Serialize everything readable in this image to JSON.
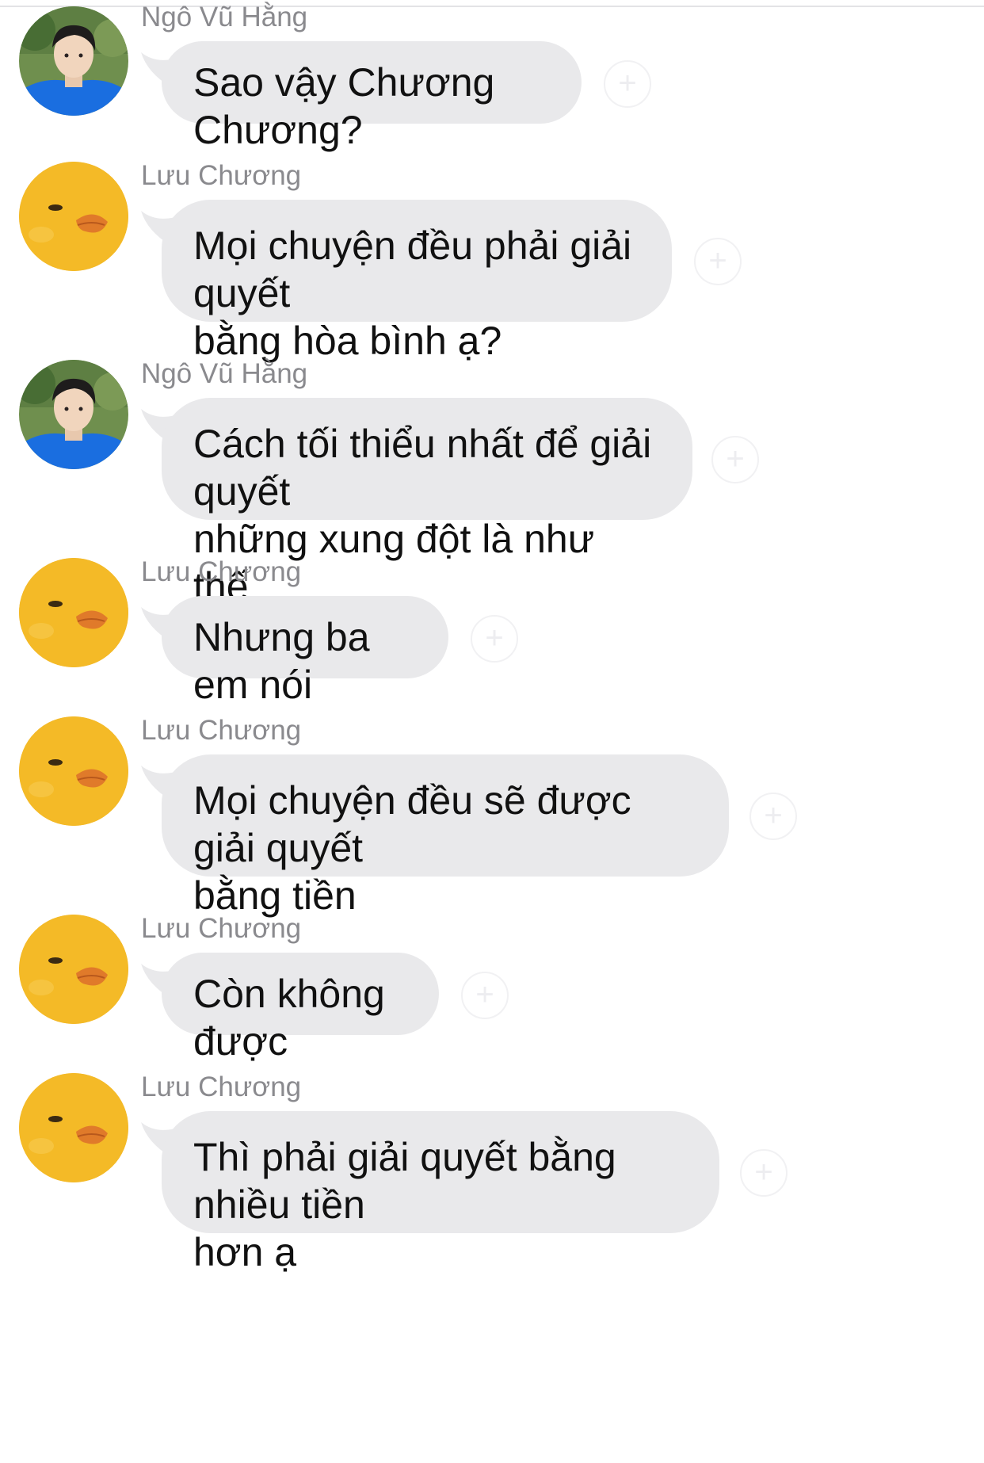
{
  "conversation": {
    "messages": [
      {
        "sender": "Ngô Vũ Hằng",
        "text": "Sao vậy Chương Chương?",
        "avatar": "boy-photo-avatar"
      },
      {
        "sender": "Lưu Chương",
        "text": "Mọi chuyện đều phải giải quyết\nbằng hòa bình ạ?",
        "avatar": "duck-avatar"
      },
      {
        "sender": "Ngô Vũ Hằng",
        "text": "Cách tối thiểu nhất để giải quyết\nnhững xung đột là như thế",
        "avatar": "boy-photo-avatar"
      },
      {
        "sender": "Lưu Chương",
        "text": "Nhưng ba em nói",
        "avatar": "duck-avatar"
      },
      {
        "sender": "Lưu Chương",
        "text": "Mọi chuyện đều sẽ được giải quyết\nbằng tiền",
        "avatar": "duck-avatar"
      },
      {
        "sender": "Lưu Chương",
        "text": "Còn không được",
        "avatar": "duck-avatar"
      },
      {
        "sender": "Lưu Chương",
        "text": "Thì phải giải quyết bằng nhiều tiền\nhơn ạ",
        "avatar": "duck-avatar"
      }
    ],
    "colors": {
      "bubble": "#e9e9eb",
      "sender_name": "#8a8a8e",
      "message_text": "#111111",
      "duck_yellow": "#f2b21c",
      "duck_beak": "#e07a2a",
      "shirt_blue": "#1a6ee0"
    },
    "icons": {
      "reaction": "add-reaction-icon"
    }
  }
}
